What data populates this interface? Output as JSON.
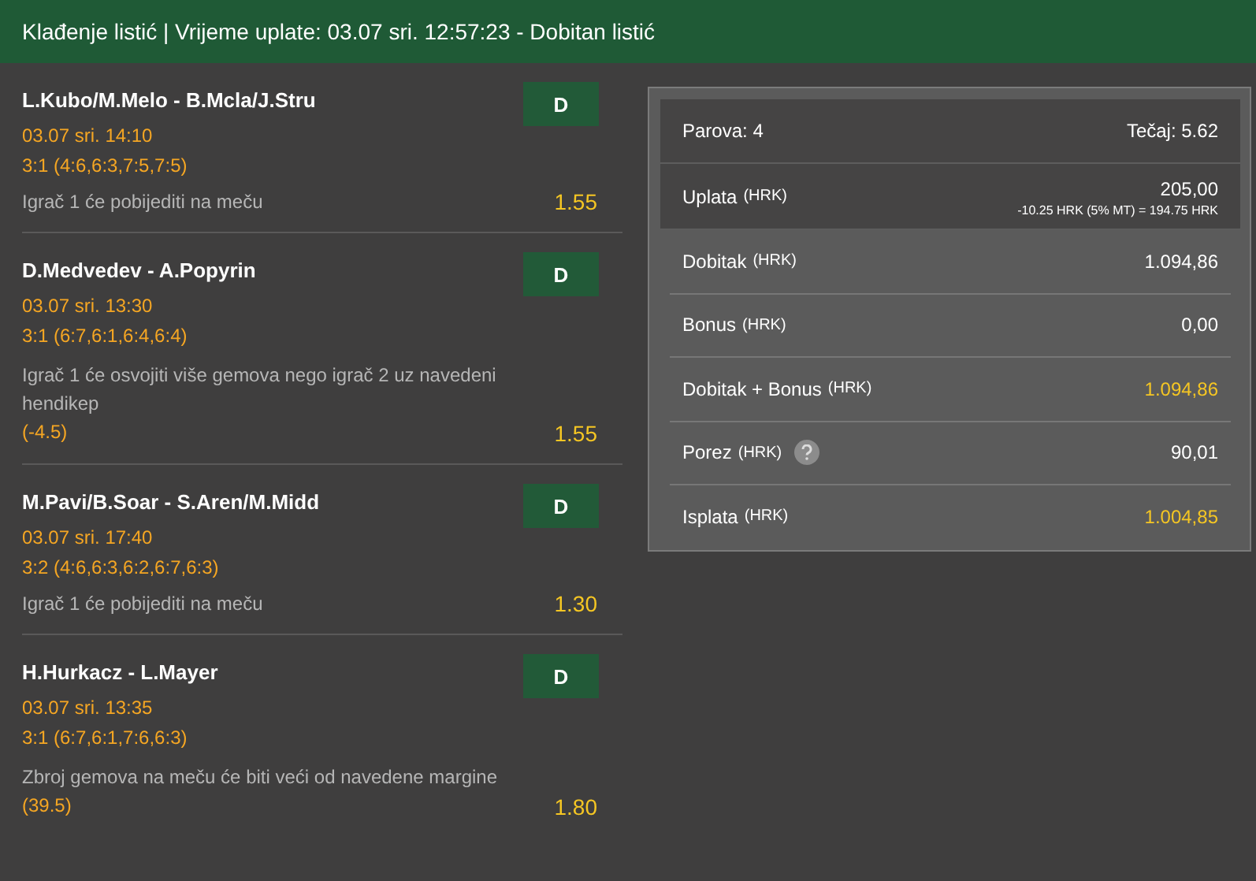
{
  "header": {
    "title": "Klađenje listić | Vrijeme uplate: 03.07 sri. 12:57:23 - Dobitan listić"
  },
  "events": [
    {
      "match": "L.Kubo/M.Melo - B.Mcla/J.Stru",
      "status": "D",
      "time": "03.07 sri. 14:10",
      "result": "3:1 (4:6,6:3,7:5,7:5)",
      "market": "Igrač 1 će pobijediti na meču",
      "odds": "1.55"
    },
    {
      "match": "D.Medvedev - A.Popyrin",
      "status": "D",
      "time": "03.07 sri. 13:30",
      "result": "3:1 (6:7,6:1,6:4,6:4)",
      "market": "Igrač 1 će osvojiti više gemova nego igrač 2 uz navedeni hendikep",
      "line": "(-4.5)",
      "odds": "1.55"
    },
    {
      "match": "M.Pavi/B.Soar - S.Aren/M.Midd",
      "status": "D",
      "time": "03.07 sri. 17:40",
      "result": "3:2 (4:6,6:3,6:2,6:7,6:3)",
      "market": "Igrač 1 će pobijediti na meču",
      "odds": "1.30"
    },
    {
      "match": "H.Hurkacz - L.Mayer",
      "status": "D",
      "time": "03.07 sri. 13:35",
      "result": "3:1 (6:7,6:1,7:6,6:3)",
      "market": "Zbroj gemova na meču će biti veći od navedene margine",
      "line": "(39.5)",
      "odds": "1.80"
    }
  ],
  "summary": {
    "pairs": "Parova: 4",
    "odds": "Tečaj: 5.62",
    "stake": {
      "label": "Uplata",
      "unit": "(HRK)",
      "value": "205,00",
      "note": "-10.25 HRK (5% MT) = 194.75 HRK"
    },
    "rows": [
      {
        "label": "Dobitak",
        "unit": "(HRK)",
        "value": "1.094,86",
        "highlight": false
      },
      {
        "label": "Bonus",
        "unit": "(HRK)",
        "value": "0,00",
        "highlight": false
      },
      {
        "label": "Dobitak + Bonus",
        "unit": "(HRK)",
        "value": "1.094,86",
        "highlight": true
      },
      {
        "label": "Porez",
        "unit": "(HRK)",
        "value": "90,01",
        "highlight": false,
        "help": true
      },
      {
        "label": "Isplata",
        "unit": "(HRK)",
        "value": "1.004,85",
        "highlight": true
      }
    ]
  }
}
